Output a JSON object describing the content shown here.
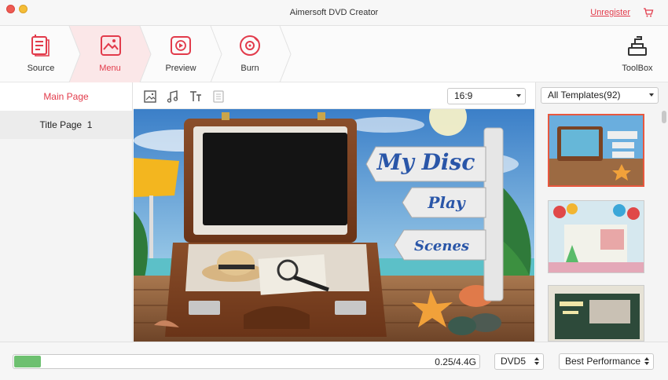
{
  "window": {
    "title": "Aimersoft DVD Creator",
    "unregister_label": "Unregister"
  },
  "steps": [
    {
      "label": "Source",
      "icon": "source-icon",
      "active": false
    },
    {
      "label": "Menu",
      "icon": "menu-icon",
      "active": true
    },
    {
      "label": "Preview",
      "icon": "preview-icon",
      "active": false
    },
    {
      "label": "Burn",
      "icon": "burn-icon",
      "active": false
    }
  ],
  "toolbox_label": "ToolBox",
  "pages": {
    "main_label": "Main Page",
    "title_label": "Title Page",
    "title_count": "1"
  },
  "preview": {
    "aspect_ratio": "16:9",
    "title_text": "My Disc",
    "play_text": "Play",
    "scenes_text": "Scenes"
  },
  "templates": {
    "filter_label": "All Templates(92)"
  },
  "bottom": {
    "usage_text": "0.25/4.4G",
    "usage_fraction": 0.057,
    "disc_type": "DVD5",
    "quality": "Best Performance"
  },
  "colors": {
    "accent": "#e23b4b",
    "progress": "#6dc070"
  }
}
